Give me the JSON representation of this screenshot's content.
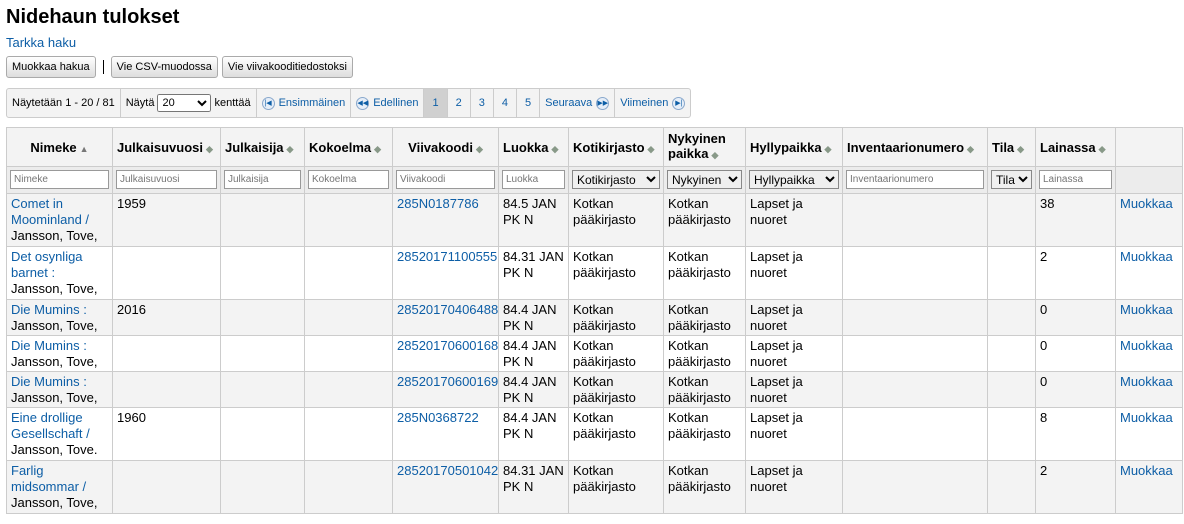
{
  "page": {
    "title": "Nidehaun tulokset",
    "advanced_search": "Tarkka haku"
  },
  "toolbar": {
    "edit_search": "Muokkaa hakua",
    "export_csv": "Vie CSV-muodossa",
    "export_barcodes": "Vie viivakooditiedostoksi"
  },
  "pager": {
    "showing": "Näytetään 1 - 20 / 81",
    "show_label": "Näytä",
    "per_page": "20",
    "fields_label": "kenttää",
    "first": "Ensimmäinen",
    "previous": "Edellinen",
    "pages": [
      "1",
      "2",
      "3",
      "4",
      "5"
    ],
    "current_page": "1",
    "next": "Seuraava",
    "last": "Viimeinen"
  },
  "table": {
    "headers": [
      "Nimeke",
      "Julkaisuvuosi",
      "Julkaisija",
      "Kokoelma",
      "Viivakoodi",
      "Luokka",
      "Kotikirjasto",
      "Nykyinen paikka",
      "Hyllypaikka",
      "Inventaarionumero",
      "Tila",
      "Lainassa",
      ""
    ],
    "filters": {
      "title": "Nimeke",
      "year": "Julkaisuvuosi",
      "publisher": "Julkaisija",
      "collection": "Kokoelma",
      "barcode": "Viivakoodi",
      "class": "Luokka",
      "homebranch": "Kotikirjasto",
      "holdingbranch": "Nykyinen",
      "location": "Hyllypaikka",
      "inventory": "Inventaarionumero",
      "status": "Tila",
      "checkouts": "Lainassa"
    },
    "rows": [
      {
        "title": "Comet in Moominland /",
        "author": "Jansson, Tove,",
        "year": "1959",
        "publisher": "",
        "collection": "",
        "barcode": "285N0187786",
        "class1": "84.5 JAN",
        "class2": "PK N",
        "home1": "Kotkan",
        "home2": "pääkirjasto",
        "cur1": "Kotkan",
        "cur2": "pääkirjasto",
        "loc1": "Lapset ja",
        "loc2": "nuoret",
        "inventory": "",
        "status": "",
        "checkouts": "38",
        "action": "Muokkaa"
      },
      {
        "title": "Det osynliga barnet :",
        "author": "Jansson, Tove,",
        "year": "",
        "publisher": "",
        "collection": "",
        "barcode": "28520171100555",
        "class1": "84.31 JAN",
        "class2": "PK N",
        "home1": "Kotkan",
        "home2": "pääkirjasto",
        "cur1": "Kotkan",
        "cur2": "pääkirjasto",
        "loc1": "Lapset ja",
        "loc2": "nuoret",
        "inventory": "",
        "status": "",
        "checkouts": "2",
        "action": "Muokkaa"
      },
      {
        "title": "Die Mumins :",
        "author": "Jansson, Tove,",
        "year": "2016",
        "publisher": "",
        "collection": "",
        "barcode": "28520170406488",
        "class1": "84.4 JAN",
        "class2": "PK N",
        "home1": "Kotkan",
        "home2": "pääkirjasto",
        "cur1": "Kotkan",
        "cur2": "pääkirjasto",
        "loc1": "Lapset ja",
        "loc2": "nuoret",
        "inventory": "",
        "status": "",
        "checkouts": "0",
        "action": "Muokkaa"
      },
      {
        "title": "Die Mumins :",
        "author": "Jansson, Tove,",
        "year": "",
        "publisher": "",
        "collection": "",
        "barcode": "28520170600168",
        "class1": "84.4 JAN",
        "class2": "PK N",
        "home1": "Kotkan",
        "home2": "pääkirjasto",
        "cur1": "Kotkan",
        "cur2": "pääkirjasto",
        "loc1": "Lapset ja",
        "loc2": "nuoret",
        "inventory": "",
        "status": "",
        "checkouts": "0",
        "action": "Muokkaa"
      },
      {
        "title": "Die Mumins :",
        "author": "Jansson, Tove,",
        "year": "",
        "publisher": "",
        "collection": "",
        "barcode": "28520170600169",
        "class1": "84.4 JAN",
        "class2": "PK N",
        "home1": "Kotkan",
        "home2": "pääkirjasto",
        "cur1": "Kotkan",
        "cur2": "pääkirjasto",
        "loc1": "Lapset ja",
        "loc2": "nuoret",
        "inventory": "",
        "status": "",
        "checkouts": "0",
        "action": "Muokkaa"
      },
      {
        "title": "Eine drollige Gesellschaft /",
        "author": "Jansson, Tove.",
        "year": "1960",
        "publisher": "",
        "collection": "",
        "barcode": "285N0368722",
        "class1": "84.4 JAN",
        "class2": "PK N",
        "home1": "Kotkan",
        "home2": "pääkirjasto",
        "cur1": "Kotkan",
        "cur2": "pääkirjasto",
        "loc1": "Lapset ja",
        "loc2": "nuoret",
        "inventory": "",
        "status": "",
        "checkouts": "8",
        "action": "Muokkaa"
      },
      {
        "title": "Farlig midsommar /",
        "author": "Jansson, Tove,",
        "year": "",
        "publisher": "",
        "collection": "",
        "barcode": "28520170501042",
        "class1": "84.31 JAN",
        "class2": "PK N",
        "home1": "Kotkan",
        "home2": "pääkirjasto",
        "cur1": "Kotkan",
        "cur2": "pääkirjasto",
        "loc1": "Lapset ja",
        "loc2": "nuoret",
        "inventory": "",
        "status": "",
        "checkouts": "2",
        "action": "Muokkaa"
      }
    ]
  }
}
